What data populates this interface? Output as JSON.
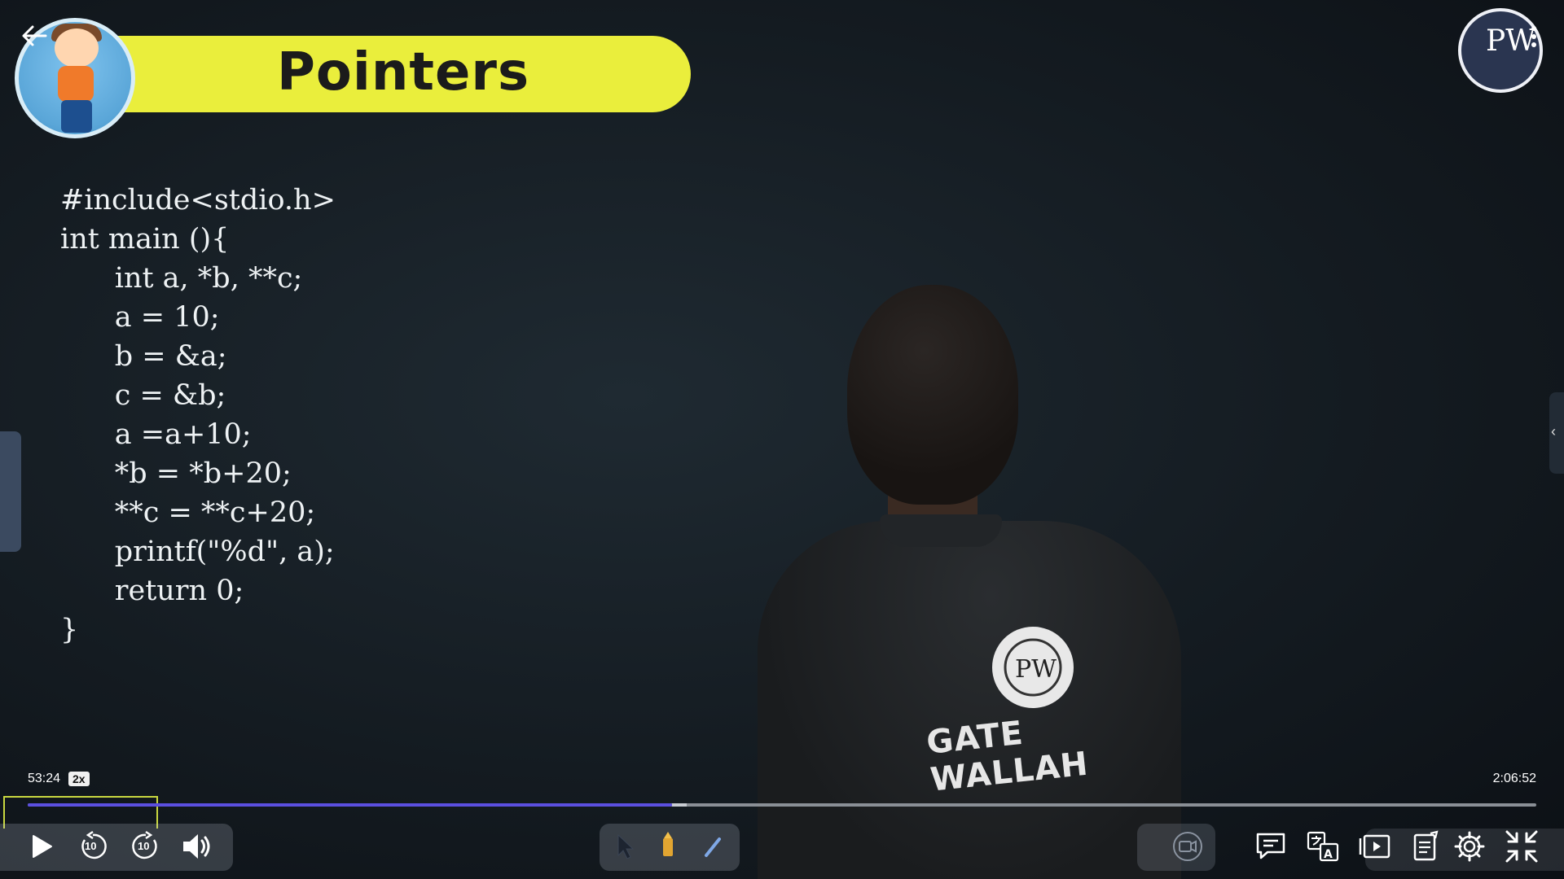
{
  "lecture": {
    "title": "Pointers",
    "code_lines": [
      "#include<stdio.h>",
      "int main (){",
      "      int a, *b, **c;",
      "      a = 10;",
      "      b = &a;",
      "      c = &b;",
      "      a =a+10;",
      "      *b = *b+20;",
      "      **c = **c+20;",
      "      printf(\"%d\", a);",
      "      return 0;",
      "}"
    ],
    "logo_text": "PW",
    "shirt_logo_text": "PW",
    "shirt_text": "GATE WALLAH"
  },
  "player": {
    "current_time": "53:24",
    "speed": "2x",
    "total_time": "2:06:52",
    "progress_fraction": 0.427,
    "buffered_fraction": 0.437,
    "rewind_seconds": "10",
    "forward_seconds": "10"
  },
  "icons": {
    "back": "back-arrow-icon",
    "more": "more-vertical-icon",
    "play": "play-icon",
    "rewind": "rewind-10-icon",
    "forward": "forward-10-icon",
    "volume": "volume-icon",
    "pointer": "pointer-tool-icon",
    "highlighter": "highlighter-tool-icon",
    "pen": "pen-tool-icon",
    "camera": "camera-icon",
    "chat": "chat-icon",
    "translate": "translate-icon",
    "playlist": "video-playlist-icon",
    "notes": "notes-icon",
    "settings": "settings-icon",
    "exit_fullscreen": "exit-fullscreen-icon"
  },
  "colors": {
    "banner": "#eaee3c",
    "progress": "#5b4fe0",
    "background": "#141b21"
  }
}
